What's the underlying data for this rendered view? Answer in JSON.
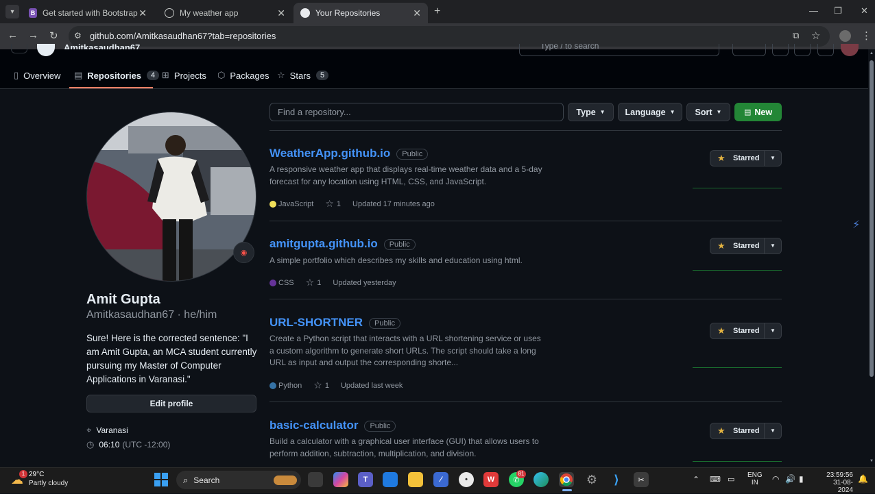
{
  "browser": {
    "tabs": [
      {
        "title": "Get started with Bootstrap · Bo",
        "favicon": "B"
      },
      {
        "title": "My weather app",
        "favicon": "globe-icon"
      },
      {
        "title": "Your Repositories",
        "favicon": "github-icon"
      }
    ],
    "url": "github.com/Amitkasaudhan67?tab=repositories"
  },
  "header": {
    "username_partial": "Amitkasaudhan67",
    "search_placeholder": "Type / to search"
  },
  "nav": {
    "overview": "Overview",
    "repositories": "Repositories",
    "repositories_count": "4",
    "projects": "Projects",
    "packages": "Packages",
    "stars": "Stars",
    "stars_count": "5"
  },
  "profile": {
    "name": "Amit Gupta",
    "login_line": "Amitkasaudhan67 · he/him",
    "bio": "Sure! Here is the corrected sentence: \"I am Amit Gupta, an MCA student currently pursuing my Master of Computer Applications in Varanasi.\"",
    "edit_label": "Edit profile",
    "location": "Varanasi",
    "time": "06:10",
    "timezone": "(UTC -12:00)"
  },
  "filters": {
    "find_placeholder": "Find a repository...",
    "type": "Type",
    "language": "Language",
    "sort": "Sort",
    "new": "New"
  },
  "repos": [
    {
      "name": "WeatherApp.github.io",
      "visibility": "Public",
      "description": "A responsive weather app that displays real-time weather data and a 5-day forecast for any location using HTML, CSS, and JavaScript.",
      "language": "JavaScript",
      "lang_color": "#f1e05a",
      "stars": "1",
      "updated": "Updated 17 minutes ago",
      "star_label": "Starred"
    },
    {
      "name": "amitgupta.github.io",
      "visibility": "Public",
      "description": "A simple portfolio which describes my skills and education using html.",
      "language": "CSS",
      "lang_color": "#663399",
      "stars": "1",
      "updated": "Updated yesterday",
      "star_label": "Starred"
    },
    {
      "name": "URL-SHORTNER",
      "visibility": "Public",
      "description": "Create a Python script that interacts with a URL shortening service or uses a custom algorithm to generate short URLs. The script should take a long URL as input and output the corresponding shorte...",
      "language": "Python",
      "lang_color": "#3572A5",
      "stars": "1",
      "updated": "Updated last week",
      "star_label": "Starred"
    },
    {
      "name": "basic-calculator",
      "visibility": "Public",
      "description": "Build a calculator with a graphical user interface (GUI) that allows users to perform addition, subtraction, multiplication, and division.",
      "star_label": "Starred"
    }
  ],
  "taskbar": {
    "weather_temp": "29°C",
    "weather_desc": "Partly cloudy",
    "weather_badge": "1",
    "search_label": "Search",
    "whatsapp_badge": "81",
    "lang_top": "ENG",
    "lang_bottom": "IN",
    "clock_time": "23:59:56",
    "clock_date": "31-08-2024"
  }
}
